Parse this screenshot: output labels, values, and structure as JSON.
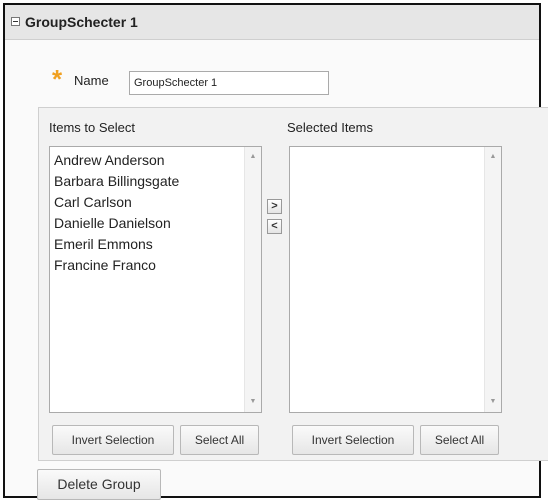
{
  "group": {
    "title": "GroupSchecter 1"
  },
  "name_field": {
    "required_mark": "*",
    "label": "Name",
    "value": "GroupSchecter 1"
  },
  "items_to_select": {
    "label": "Items to Select",
    "items": [
      "Andrew Anderson",
      "Barbara Billingsgate",
      "Carl Carlson",
      "Danielle Danielson",
      "Emeril Emmons",
      "Francine Franco"
    ],
    "invert_label": "Invert Selection",
    "select_all_label": "Select All"
  },
  "selected_items": {
    "label": "Selected Items",
    "items": [],
    "invert_label": "Invert Selection",
    "select_all_label": "Select All"
  },
  "move_buttons": {
    "add": ">",
    "remove": "<"
  },
  "actions": {
    "delete_group_label": "Delete Group"
  },
  "icons": {
    "collapse": "collapse-icon",
    "scroll_up": "scroll-up-arrow-icon",
    "scroll_down": "scroll-down-arrow-icon"
  },
  "colors": {
    "required_star": "#f0a020",
    "title_bar": "#e6e6e6",
    "panel_bg": "#f2f2f2"
  }
}
